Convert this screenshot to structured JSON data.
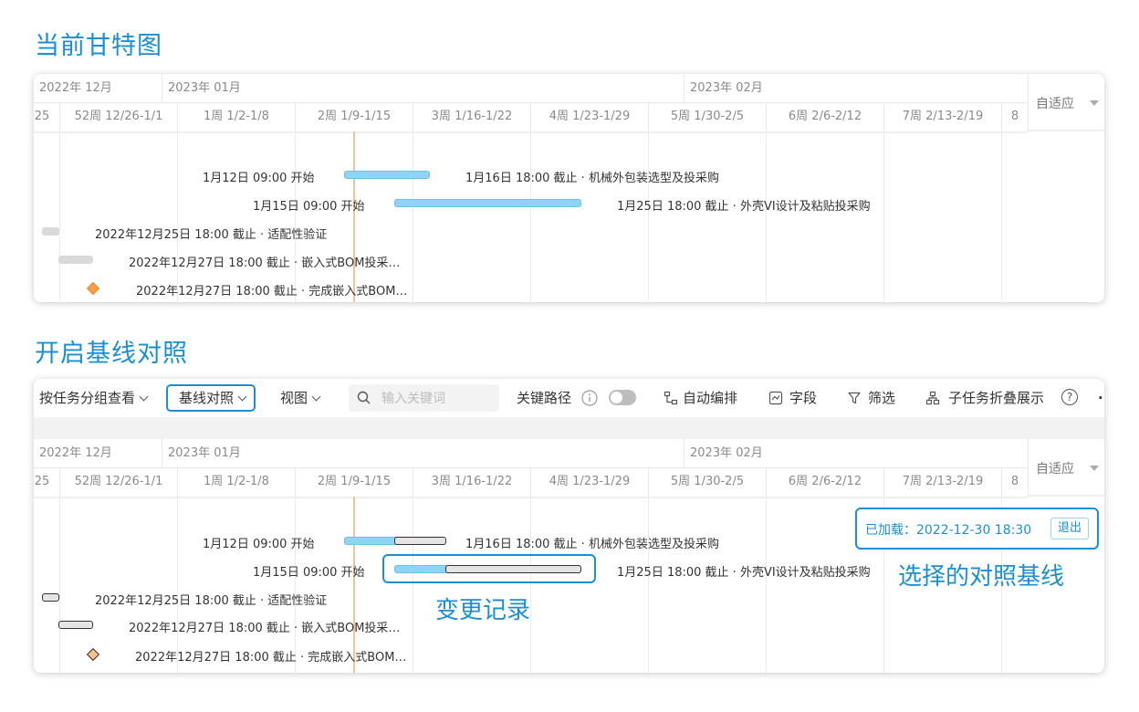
{
  "titles": {
    "current": "当前甘特图",
    "baseline": "开启基线对照"
  },
  "timeline": {
    "months": [
      "2022年 12月",
      "2023年 01月",
      "2023年 02月"
    ],
    "weeks": [
      "25",
      "52周 12/26-1/1",
      "1周 1/2-1/8",
      "2周 1/9-1/15",
      "3周 1/16-1/22",
      "4周 1/23-1/29",
      "5周 1/30-2/5",
      "6周 2/6-2/12",
      "7周 2/13-2/19",
      "8"
    ],
    "fit": "自适应"
  },
  "tasks": [
    {
      "start_label": "1月12日 09:00 开始",
      "end_label": "1月16日 18:00 截止 · 机械外包装选型及投采购"
    },
    {
      "start_label": "1月15日 09:00 开始",
      "end_label": "1月25日 18:00 截止 · 外壳VI设计及粘贴投采购"
    },
    {
      "end_label": "2022年12月25日 18:00 截止 · 适配性验证"
    },
    {
      "end_label": "2022年12月27日 18:00 截止 · 嵌入式BOM投采…"
    },
    {
      "end_label": "2022年12月27日 18:00 截止 · 完成嵌入式BOM…"
    }
  ],
  "toolbar": {
    "group_view": "按任务分组查看",
    "baseline": "基线对照",
    "view": "视图",
    "search_placeholder": "输入关键词",
    "critical_path": "关键路径",
    "auto_schedule": "自动编排",
    "fields": "字段",
    "filter": "筛选",
    "collapse_subtasks": "子任务折叠展示",
    "help": "?",
    "more": "·"
  },
  "baseline_info": {
    "loaded": "已加载：2022-12-30 18:30",
    "exit": "退出"
  },
  "annotations": {
    "change_record": "变更记录",
    "selected_baseline": "选择的对照基线"
  },
  "colors": {
    "accent": "#1a8fd1",
    "bar": "#8fd3f7",
    "milestone": "#f7a04a",
    "today": "#f7c28e"
  }
}
